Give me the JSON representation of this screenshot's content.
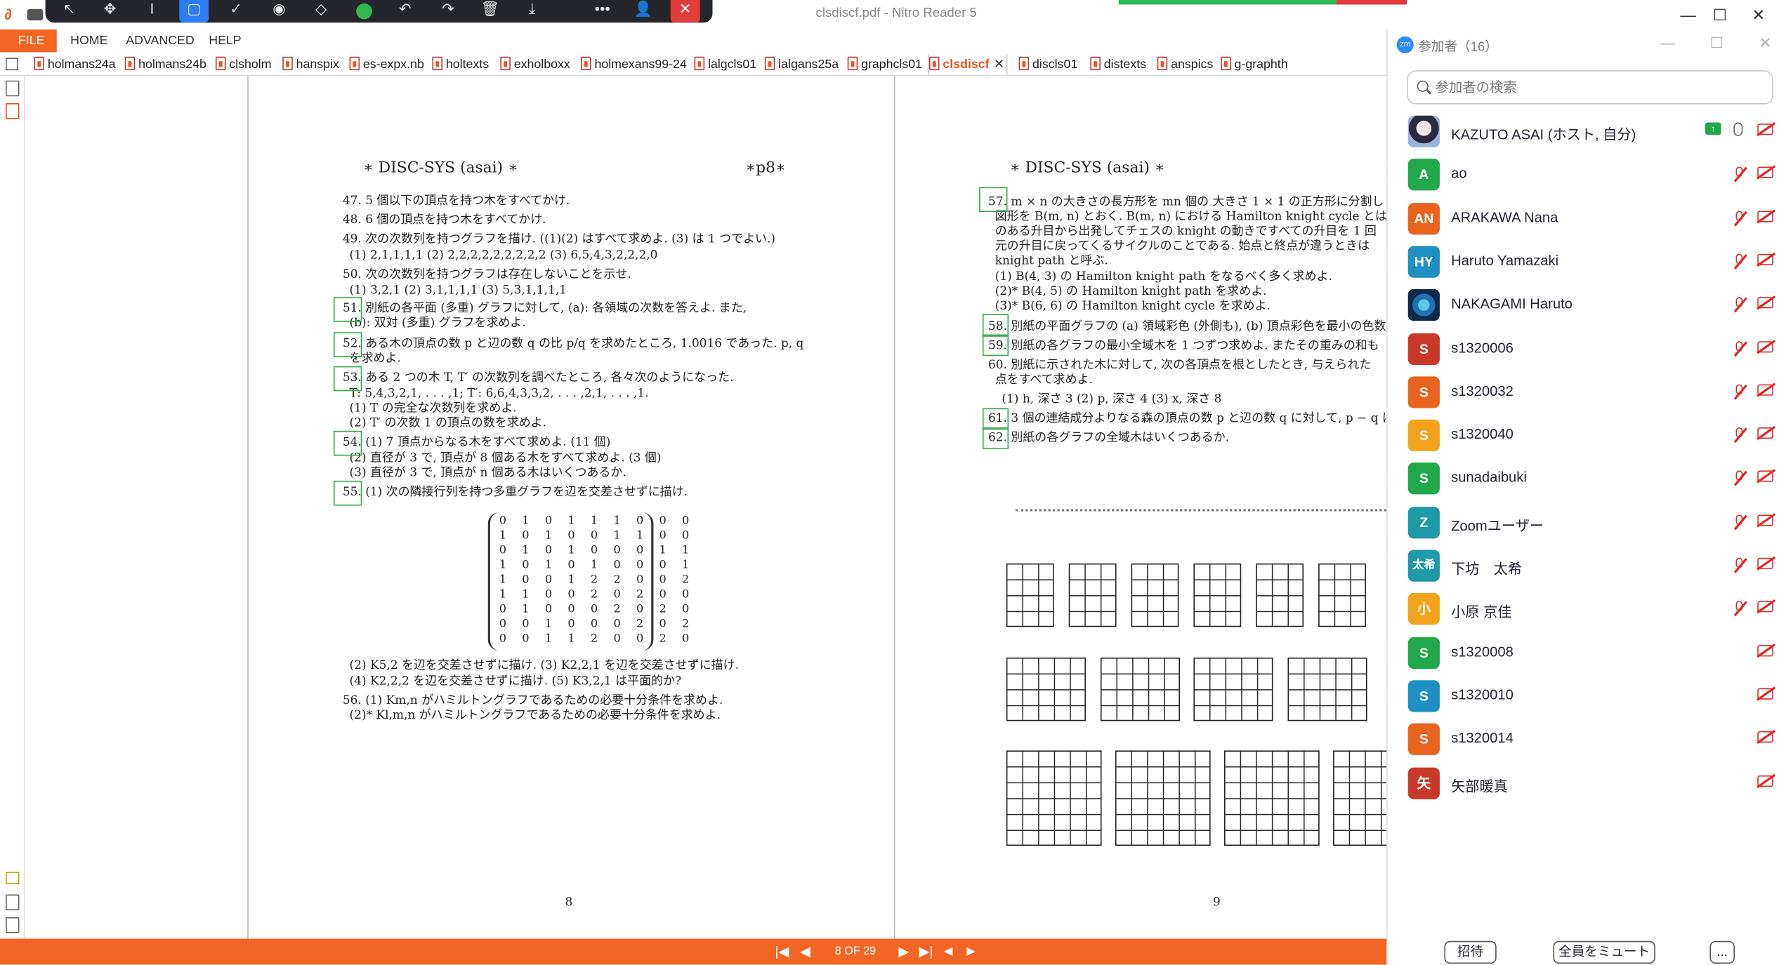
{
  "window": {
    "title": "clsdiscf.pdf - Nitro Reader 5",
    "controls": {
      "minimize": "—",
      "maximize": "☐",
      "close": "✕"
    }
  },
  "floating_toolbar": {
    "icons": [
      "pointer-icon",
      "move-icon",
      "text-cursor-icon",
      "rectangle-icon",
      "check-icon",
      "stamp-icon",
      "eraser-icon",
      "color-dot-icon",
      "undo-icon",
      "redo-icon",
      "trash-icon",
      "download-icon",
      "more-icon",
      "people-icon",
      "close-icon"
    ],
    "glyphs": {
      "pointer": "↖",
      "move": "✥",
      "text": "I",
      "rect": "▢",
      "check": "✓",
      "stamp": "◉",
      "eraser": "◇",
      "undo": "↶",
      "redo": "↷",
      "trash": "🗑",
      "download": "⤓",
      "more": "•••",
      "people": "👤",
      "close": "✕"
    }
  },
  "menu": {
    "file": "FILE",
    "items": [
      "HOME",
      "ADVANCED",
      "HELP"
    ]
  },
  "tabs": [
    "holmans24a",
    "holmans24b",
    "clsholm",
    "hanspix",
    "es-expx.nb",
    "holtexts",
    "exholboxx",
    "holmexans99-24",
    "lalgcls01",
    "lalgans25a",
    "graphcls01",
    "clsdiscf",
    "discls01",
    "distexts",
    "anspics",
    "g-graphth"
  ],
  "active_tab": "clsdiscf",
  "active_tab_close": "✕",
  "pages": {
    "left": {
      "header": "∗ DISC-SYS (asai) ∗",
      "header_right": "∗p8∗",
      "lines": [
        "47. 5 個以下の頂点を持つ木をすべてかけ.",
        "48. 6 個の頂点を持つ木をすべてかけ.",
        "49. 次の次数列を持つグラフを描け. ((1)(2) はすべて求めよ. (3) は 1 つでよい.)",
        "(1) 2,1,1,1,1        (2) 2,2,2,2,2,2,2,2,2        (3) 6,5,4,3,2,2,2,0",
        "50. 次の次数列を持つグラフは存在しないことを示せ.",
        "(1) 3,2,1        (2) 3,1,1,1,1        (3) 5,3,1,1,1,1",
        "51. 別紙の各平面 (多重) グラフに対して, (a): 各領域の次数を答えよ. また,",
        "(b): 双対 (多重) グラフを求めよ.",
        "52. ある木の頂点の数 p と辺の数 q の比 p/q を求めたところ, 1.0016 であった. p, q",
        "を求めよ.",
        "53. ある 2 つの木 T, T′ の次数列を調べたところ, 各々次のようになった.",
        "T: 5,4,3,2,1, . . . ,1;  T′: 6,6,4,3,3,2, . . . ,2,1, . . . ,1.",
        "(1) T の完全な次数列を求めよ.",
        "(2) T′ の次数 1 の頂点の数を求めよ.",
        "54. (1) 7 頂点からなる木をすべて求めよ. (11 個)",
        "(2) 直径が 3 で, 頂点が 8 個ある木をすべて求めよ. (3 個)",
        "(3) 直径が 3 で, 頂点が n 個ある木はいくつあるか.",
        "55. (1) 次の隣接行列を持つ多重グラフを辺を交差させずに描け.",
        "(2) K5,2 を辺を交差させずに描け.    (3) K2,2,1 を辺を交差させずに描け.",
        "(4) K2,2,2 を辺を交差させずに描け.    (5) K3,2,1 は平面的か?",
        "56. (1) Km,n がハミルトングラフであるための必要十分条件を求めよ.",
        "(2)* Kl,m,n がハミルトングラフであるための必要十分条件を求めよ."
      ],
      "matrix": [
        "0 1 0 1 1 1 0 0 0",
        "1 0 1 0 0 1 1 0 0",
        "0 1 0 1 0 0 0 1 1",
        "1 0 1 0 1 0 0 0 1",
        "1 0 0 1 2 2 0 0 2",
        "1 1 0 0 2 0 2 0 0",
        "0 1 0 0 0 2 0 2 0",
        "0 0 1 0 0 0 2 0 2",
        "0 0 1 1 2 0 0 2 0"
      ],
      "page_number": "8"
    },
    "right": {
      "header": "∗ DISC-SYS (asai) ∗",
      "lines": [
        "57. m × n の大きさの長方形を mn 個の 大きさ 1 × 1 の正方形に分割し",
        "図形を B(m, n) とおく. B(m, n) における Hamilton knight cycle とは",
        "のある升目から出発してチェスの knight の動きですべての升目を 1 回",
        "元の升目に戻ってくるサイクルのことである. 始点と終点が違うときは",
        "knight path と呼ぶ.",
        "(1) B(4, 3) の Hamilton knight path をなるべく多く求めよ.",
        "(2)* B(4, 5) の Hamilton knight path を求めよ.",
        "(3)* B(6, 6) の Hamilton knight cycle を求めよ.",
        "58. 別紙の平面グラフの (a) 領域彩色 (外側も), (b) 頂点彩色を最小の色数",
        "59. 別紙の各グラフの最小全域木を 1 つずつ求めよ. またその重みの和も",
        "60. 別紙に示された木に対して, 次の各頂点を根としたとき, 与えられた",
        "点をすべて求めよ.",
        "(1) h, 深さ 3    (2) p, 深さ 4    (3) x, 深さ 8",
        "61. 3 個の連結成分よりなる森の頂点の数 p と辺の数 q に対して, p − q は",
        "62. 別紙の各グラフの全域木はいくつあるか."
      ],
      "page_number": "9"
    }
  },
  "status": {
    "page_indicator": "8 OF 29",
    "nav": {
      "first": "|◀",
      "prev": "◀",
      "next": "▶",
      "last": "▶|",
      "back": "◀",
      "forward": "▶"
    }
  },
  "participants_panel": {
    "title": "参加者（16）",
    "search_placeholder": "参加者の検索",
    "colors": {
      "green": "#20a84b",
      "orange": "#e8641e",
      "blue": "#1f8fc4",
      "yellow": "#f2a21b",
      "red": "#c9392a",
      "teal": "#1f9aa8"
    },
    "participants": [
      {
        "name": "KAZUTO ASAI (ホスト, 自分)",
        "initials": "",
        "color": "",
        "mic": "on",
        "sharing": true
      },
      {
        "name": "ao",
        "initials": "A",
        "color": "#20a84b",
        "mic": "muted"
      },
      {
        "name": "ARAKAWA Nana",
        "initials": "AN",
        "color": "#e8641e",
        "mic": "muted"
      },
      {
        "name": "Haruto Yamazaki",
        "initials": "HY",
        "color": "#1f8fc4",
        "mic": "muted"
      },
      {
        "name": "NAKAGAMI Haruto",
        "initials": "",
        "color": "",
        "mic": "muted"
      },
      {
        "name": "s1320006",
        "initials": "S",
        "color": "#c9392a",
        "mic": "muted"
      },
      {
        "name": "s1320032",
        "initials": "S",
        "color": "#e8641e",
        "mic": "muted"
      },
      {
        "name": "s1320040",
        "initials": "S",
        "color": "#f2a21b",
        "mic": "muted"
      },
      {
        "name": "sunadaibuki",
        "initials": "S",
        "color": "#20a84b",
        "mic": "muted"
      },
      {
        "name": "Zoomユーザー",
        "initials": "Z",
        "color": "#1f9aa8",
        "mic": "muted"
      },
      {
        "name": "下坊　太希",
        "initials": "太希",
        "color": "#1f9aa8",
        "mic": "muted"
      },
      {
        "name": "小原 京佳",
        "initials": "小",
        "color": "#f2a21b",
        "mic": "muted"
      },
      {
        "name": "s1320008",
        "initials": "S",
        "color": "#20a84b",
        "mic": "none"
      },
      {
        "name": "s1320010",
        "initials": "S",
        "color": "#1f8fc4",
        "mic": "none"
      },
      {
        "name": "s1320014",
        "initials": "S",
        "color": "#e8641e",
        "mic": "none"
      },
      {
        "name": "矢部暖真",
        "initials": "矢",
        "color": "#c9392a",
        "mic": "none"
      }
    ],
    "footer": {
      "invite": "招待",
      "mute_all": "全員をミュート",
      "more": "..."
    }
  }
}
